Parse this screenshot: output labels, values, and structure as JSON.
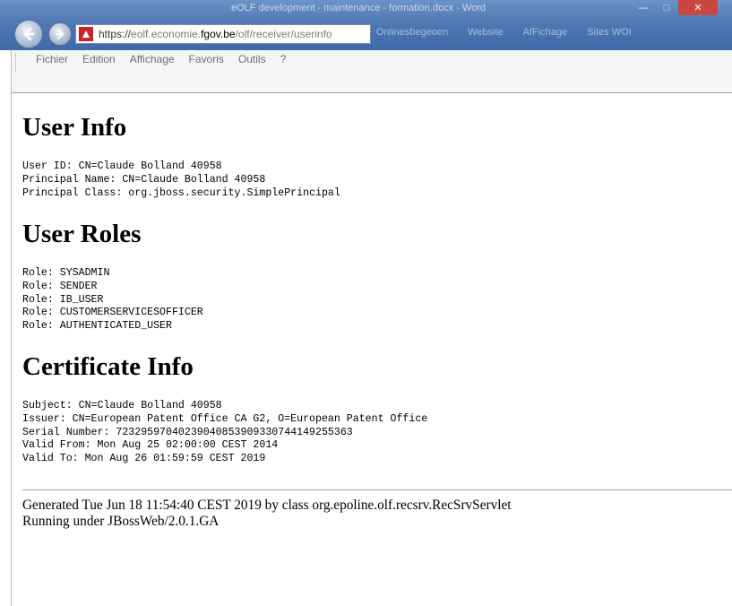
{
  "window": {
    "title": "eOLF development - maintenance - formation.docx - Word",
    "minimize_glyph": "—",
    "maximize_glyph": "□",
    "close_glyph": "✕"
  },
  "address_bar": {
    "protocol": "https://",
    "domain_prefix": "eolf.economie.",
    "domain": "fgov.be",
    "path": "/olf/receiver/userinfo"
  },
  "background_tabs": [
    "Onlinesbegeoen",
    "Website",
    "AfFichage",
    "Sites WOI"
  ],
  "menu": [
    "Fichier",
    "Edition",
    "Affichage",
    "Favoris",
    "Outils",
    "?"
  ],
  "page": {
    "user_info": {
      "heading": "User Info",
      "lines": [
        "User ID: CN=Claude Bolland 40958",
        "Principal Name: CN=Claude Bolland 40958",
        "Principal Class: org.jboss.security.SimplePrincipal"
      ]
    },
    "user_roles": {
      "heading": "User Roles",
      "lines": [
        "Role: SYSADMIN",
        "Role: SENDER",
        "Role: IB_USER",
        "Role: CUSTOMERSERVICESOFFICER",
        "Role: AUTHENTICATED_USER"
      ]
    },
    "certificate_info": {
      "heading": "Certificate Info",
      "lines": [
        "Subject: CN=Claude Bolland 40958",
        "Issuer: CN=European Patent Office CA G2, O=European Patent Office",
        "Serial Number: 72329597040239040853909330744149255363",
        "Valid From: Mon Aug 25 02:00:00 CEST 2014",
        "Valid To: Mon Aug 26 01:59:59 CEST 2019"
      ]
    },
    "footer": {
      "generated": "Generated Tue Jun 18 11:54:40 CEST 2019 by class org.epoline.olf.recsrv.RecSrvServlet",
      "running": "Running under JBossWeb/2.0.1.GA"
    }
  }
}
